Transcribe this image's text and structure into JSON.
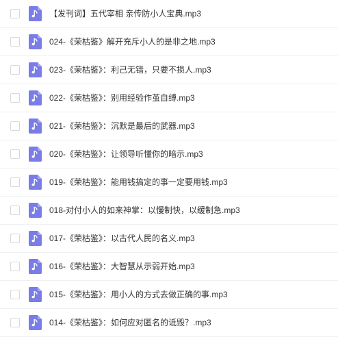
{
  "colors": {
    "icon_bg": "#7a7ce8",
    "icon_fold": "#a5a7f0",
    "text": "#333333",
    "divider": "#eef0f4",
    "checkbox_border": "#d6d9df"
  },
  "row_icon": "music-note-file-icon",
  "files": [
    {
      "name": "【发刊词】五代宰相 亲传防小人宝典.mp3"
    },
    {
      "name": "024-《荣枯鉴》解开充斥小人的是非之地.mp3"
    },
    {
      "name": "023-《荣枯鉴》：利己无错，只要不损人.mp3"
    },
    {
      "name": "022-《荣枯鉴》：别用经验作茧自缚.mp3"
    },
    {
      "name": "021-《荣枯鉴》：沉默是最后的武器.mp3"
    },
    {
      "name": "020-《荣枯鉴》：让领导听懂你的暗示.mp3"
    },
    {
      "name": "019-《荣枯鉴》：能用钱搞定的事一定要用钱.mp3"
    },
    {
      "name": "018-对付小人的如来神掌：以慢制快，以缓制急.mp3"
    },
    {
      "name": "017-《荣枯鉴》：以古代人民的名义.mp3"
    },
    {
      "name": "016-《荣枯鉴》：大智慧从示弱开始.mp3"
    },
    {
      "name": "015-《荣枯鉴》：用小人的方式去做正确的事.mp3"
    },
    {
      "name": "014-《荣枯鉴》：如何应对匿名的诋毁？.mp3"
    }
  ]
}
